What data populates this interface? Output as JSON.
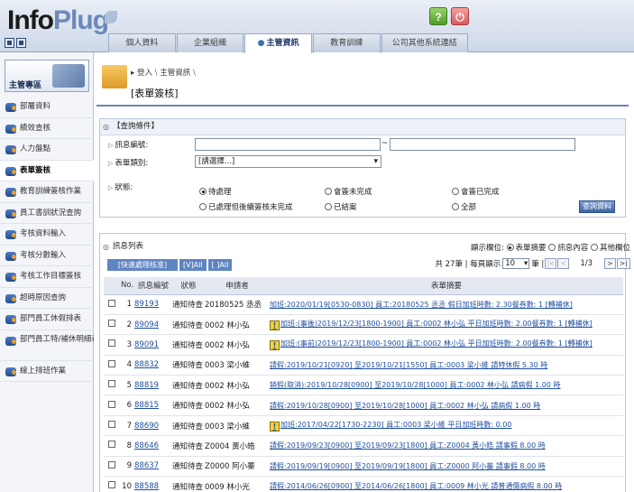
{
  "app": {
    "logo_main": "Info",
    "logo_accent": "Plug"
  },
  "tabs": [
    "個人資料",
    "企業組織",
    "主管資訊",
    "教育訓練",
    "公司其他系統連結"
  ],
  "sidebar": {
    "title": "主管專區",
    "items": [
      "部屬資料",
      "績效查核",
      "人力盤點",
      "表單簽核",
      "教育訓練簽核作業",
      "員工書訓狀況查詢",
      "考核資料輸入",
      "考核分數輸入",
      "考核工作目標簽核",
      "超時原因查詢",
      "部門員工休假排表",
      "部門員工特/補休明細表",
      "線上排班作業"
    ],
    "active": "表單簽核"
  },
  "breadcrumb": {
    "login": "登入",
    "current": "主管資訊"
  },
  "page_title": "[表單簽核]",
  "query": {
    "header": "【查詢條件】",
    "msg_no_label": "訊息編號:",
    "tilde": "~",
    "type_label": "表單類別:",
    "type_value": "[請選擇...]",
    "status_label": "狀態:",
    "status_options": [
      "待處理",
      "會簽未完成",
      "會簽已完成",
      "已處理但後續簽核未完成",
      "已結案",
      "全部"
    ],
    "status_selected": "待處理",
    "button": "查詢資料"
  },
  "list": {
    "header": "訊息列表",
    "display_label": "顯示欄位:",
    "display_options": [
      "表單摘要",
      "訊息內容",
      "其他欄位"
    ],
    "display_selected": "表單摘要",
    "quick_labels": [
      "[快速處理核准]",
      "[V]All",
      "[ ]All"
    ],
    "total_text": "共 27筆 | 每頁顯示",
    "page_size": "10",
    "per_page_unit": "筆 |",
    "page_info": "1/3",
    "pager_btns": [
      "|<",
      "<",
      ">",
      ">|"
    ]
  },
  "table": {
    "columns": [
      "No.",
      "訊息編號",
      "狀態",
      "申請者",
      "表單摘要"
    ],
    "rows": [
      {
        "no": "1",
        "id": "89193",
        "status": "通知待查",
        "applicant": "20180525 丞丞",
        "summary": "加班:2020/01/19[0530-0830] 員工:20180525 丞丞 假日加班時數: 2.30餐券數: 1 [轉補休]",
        "warn": false
      },
      {
        "no": "2",
        "id": "89094",
        "status": "通知待查",
        "applicant": "0002 林小弘",
        "summary": "加班:(事後)2019/12/23[1800-1900] 員工:0002 林小弘 平日加班時數: 2.00餐券數: 1 [轉補休]",
        "warn": true
      },
      {
        "no": "3",
        "id": "89091",
        "status": "通知待查",
        "applicant": "0002 林小弘",
        "summary": "加班:(事前)2019/12/23[1800-1900] 員工:0002 林小弘 平日加班時數: 2.00餐券數: 1 [轉補休]",
        "warn": true
      },
      {
        "no": "4",
        "id": "88832",
        "status": "通知待查",
        "applicant": "0003 梁小維",
        "summary": "請假:2019/10/21[0920] 至2019/10/21[1550] 員工:0003 梁小維 請特休假 5.30 時",
        "warn": false
      },
      {
        "no": "5",
        "id": "88819",
        "status": "通知待查",
        "applicant": "0002 林小弘",
        "summary": "銷假(取消):2019/10/28[0900] 至2019/10/28[1000] 員工:0002 林小弘 請病假 1.00 時",
        "warn": false
      },
      {
        "no": "6",
        "id": "88815",
        "status": "通知待查",
        "applicant": "0002 林小弘",
        "summary": "請假:2019/10/28[0900] 至2019/10/28[1000] 員工:0002 林小弘 請病假 1.00 時",
        "warn": false
      },
      {
        "no": "7",
        "id": "88690",
        "status": "通知待查",
        "applicant": "0003 梁小維",
        "summary": "加班:2017/04/22[1730-2230] 員工:0003 梁小維 平日加班時數: 0.00",
        "warn": true
      },
      {
        "no": "8",
        "id": "88646",
        "status": "通知待查",
        "applicant": "Z0004 黃小皓",
        "summary": "請假:2019/09/23[0900] 至2019/09/23[1800] 員工:Z0004 黃小皓 請事假 8.00 時",
        "warn": false
      },
      {
        "no": "9",
        "id": "88637",
        "status": "通知待查",
        "applicant": "Z0000 阿小蓁",
        "summary": "請假:2019/09/19[0900] 至2019/09/19[1800] 員工:Z0000 阿小蓁 請事假 8.00 時",
        "warn": false
      },
      {
        "no": "10",
        "id": "88588",
        "status": "通知待查",
        "applicant": "0009 林小光",
        "summary": "請假:2014/06/26[0900] 至2014/06/26[1800] 員工:0009 林小光 請普通傷病假 8.00 時",
        "warn": false
      }
    ]
  }
}
